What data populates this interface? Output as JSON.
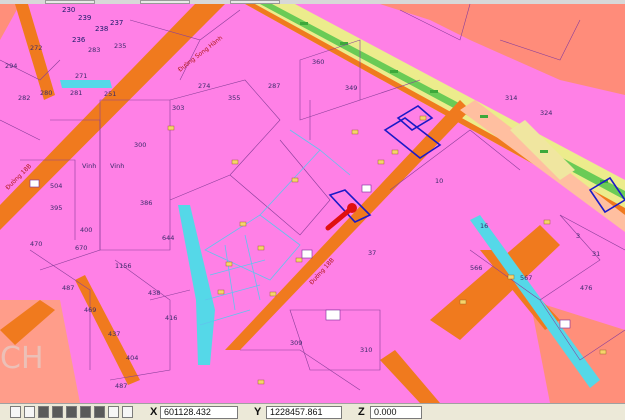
{
  "map": {
    "watermark": "CH",
    "road_labels": [
      "Đường 18B",
      "Đường Song Hành",
      "Đường 18B"
    ],
    "parcels": [
      {
        "label": "230"
      },
      {
        "label": "239"
      },
      {
        "label": "238"
      },
      {
        "label": "237"
      },
      {
        "label": "236"
      },
      {
        "label": "272"
      },
      {
        "label": "283"
      },
      {
        "label": "235"
      },
      {
        "label": "294"
      },
      {
        "label": "280"
      },
      {
        "label": "281"
      },
      {
        "label": "282"
      },
      {
        "label": "271"
      },
      {
        "label": "251"
      },
      {
        "label": "314"
      },
      {
        "label": "324"
      },
      {
        "label": "Vinh"
      },
      {
        "label": "274"
      },
      {
        "label": "355"
      },
      {
        "label": "360"
      },
      {
        "label": "287"
      },
      {
        "label": "303"
      },
      {
        "label": "300"
      },
      {
        "label": "349"
      },
      {
        "label": "386"
      },
      {
        "label": "395"
      },
      {
        "label": "400"
      },
      {
        "label": "470"
      },
      {
        "label": "504"
      },
      {
        "label": "Vinh"
      },
      {
        "label": "670"
      },
      {
        "label": "644"
      },
      {
        "label": "1156"
      },
      {
        "label": "487"
      },
      {
        "label": "438"
      },
      {
        "label": "469"
      },
      {
        "label": "437"
      },
      {
        "label": "416"
      },
      {
        "label": "404"
      },
      {
        "label": "487"
      },
      {
        "label": "309"
      },
      {
        "label": "310"
      },
      {
        "label": "37"
      },
      {
        "label": "10"
      },
      {
        "label": "16"
      },
      {
        "label": "31"
      },
      {
        "label": "3"
      },
      {
        "label": "566"
      },
      {
        "label": "567"
      },
      {
        "label": "476"
      }
    ]
  },
  "statusbar": {
    "x_label": "X",
    "x_value": "601128.432",
    "y_label": "Y",
    "y_value": "1228457.861",
    "z_label": "Z",
    "z_value": "0.000"
  }
}
